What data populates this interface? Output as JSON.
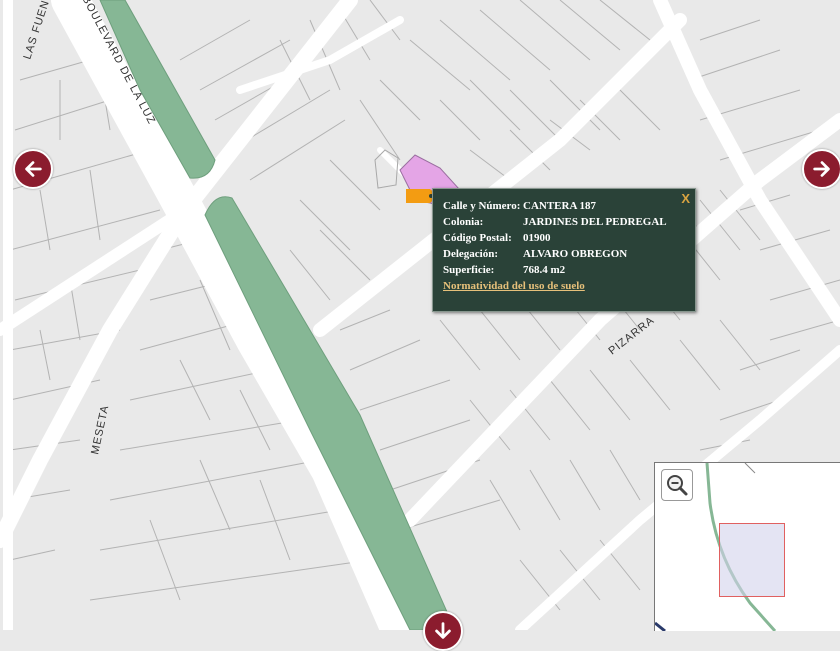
{
  "map": {
    "streets": {
      "las_fuentes": "LAS FUENTES",
      "boulevard": "BOULEVARD DE LA LUZ",
      "meseta": "MESETA",
      "pizarra": "PIZARRA"
    },
    "colors": {
      "background": "#e9e9e9",
      "street": "#ffffff",
      "lot_line": "#b3b3b3",
      "median": "#86b795",
      "parcel_highlight": "#e4a5e6",
      "marker": "#f39c12"
    }
  },
  "navigation": {
    "left_icon": "arrow-left-icon",
    "right_icon": "arrow-right-icon",
    "down_icon": "arrow-down-icon",
    "color": "#8b1c2e"
  },
  "popup": {
    "close_label": "X",
    "rows": [
      {
        "label": "Calle y Número:",
        "value": "CANTERA 187"
      },
      {
        "label": "Colonia:",
        "value": "JARDINES DEL PEDREGAL"
      },
      {
        "label": "Código Postal:",
        "value": "01900"
      },
      {
        "label": "Delegación:",
        "value": "ALVARO OBREGON"
      },
      {
        "label": "Superficie:",
        "value": "768.4 m2"
      }
    ],
    "link_label": "Normatividad del uso de suelo",
    "background": "#2a4238",
    "link_color": "#e6c07a"
  },
  "overview": {
    "zoom_icon": "zoom-out-icon"
  }
}
